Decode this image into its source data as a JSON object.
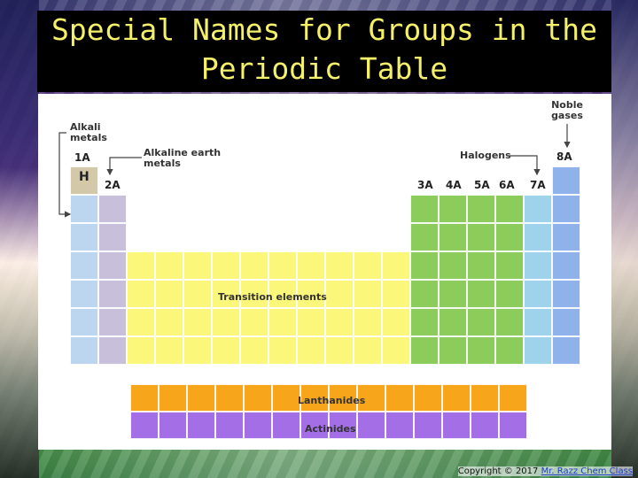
{
  "title": {
    "line1": "Special Names for Groups in the",
    "line2": "Periodic Table"
  },
  "labels": {
    "alkali_metals": "Alkali metals",
    "alkaline_earth_metals": "Alkaline earth metals",
    "noble_gases": "Noble gases",
    "halogens": "Halogens",
    "transition_elements": "Transition elements",
    "lanthanides": "Lanthanides",
    "actinides": "Actinides",
    "hydrogen_symbol": "H"
  },
  "groups": {
    "g1": "1A",
    "g2": "2A",
    "g3": "3A",
    "g4": "4A",
    "g5": "5A",
    "g6": "6A",
    "g7": "7A",
    "g8": "8A"
  },
  "footer": {
    "copyright": "Copyright © 2017 ",
    "link": "Mr. Razz Chem Class"
  },
  "colors": {
    "alkali": "#bdd6f0",
    "alkaline_earth": "#c8bfdb",
    "transition": "#fbf77b",
    "main_group": "#8ccc5b",
    "halogens": "#9fd3ec",
    "noble_gases": "#8fb2ea",
    "lanthanides": "#f7a51a",
    "actinides": "#a36ee6"
  }
}
